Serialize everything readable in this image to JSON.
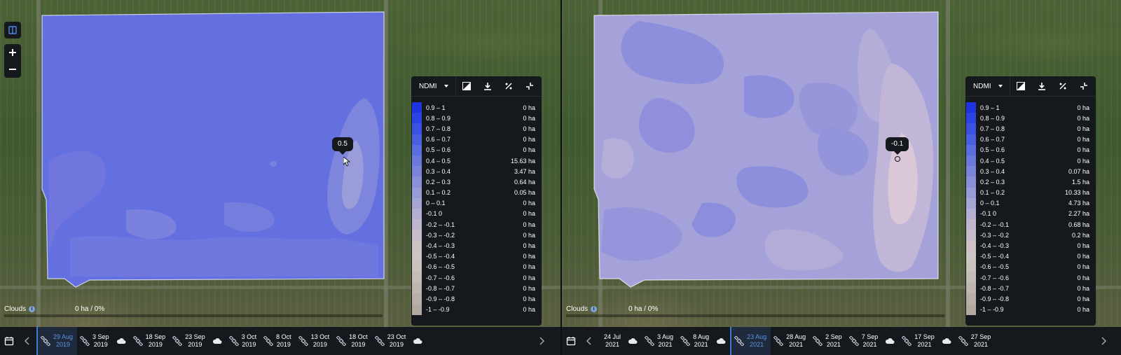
{
  "left": {
    "index_name": "NDMI",
    "tooltip_value": "0.5",
    "clouds_label": "Clouds",
    "clouds_info": "i",
    "area_pct": "0 ha / 0%",
    "legend": [
      {
        "range": "0.9 – 1",
        "area": "0 ha"
      },
      {
        "range": "0.8 – 0.9",
        "area": "0 ha"
      },
      {
        "range": "0.7 – 0.8",
        "area": "0 ha"
      },
      {
        "range": "0.6 – 0.7",
        "area": "0 ha"
      },
      {
        "range": "0.5 – 0.6",
        "area": "0 ha"
      },
      {
        "range": "0.4 – 0.5",
        "area": "15.63 ha"
      },
      {
        "range": "0.3 – 0.4",
        "area": "3.47 ha"
      },
      {
        "range": "0.2 – 0.3",
        "area": "0.64 ha"
      },
      {
        "range": "0.1 – 0.2",
        "area": "0.05 ha"
      },
      {
        "range": "0 – 0.1",
        "area": "0 ha"
      },
      {
        "range": "-0.1 0",
        "area": "0 ha"
      },
      {
        "range": "-0.2 – -0.1",
        "area": "0 ha"
      },
      {
        "range": "-0.3 – -0.2",
        "area": "0 ha"
      },
      {
        "range": "-0.4 – -0.3",
        "area": "0 ha"
      },
      {
        "range": "-0.5 – -0.4",
        "area": "0 ha"
      },
      {
        "range": "-0.6 – -0.5",
        "area": "0 ha"
      },
      {
        "range": "-0.7 – -0.6",
        "area": "0 ha"
      },
      {
        "range": "-0.8 – -0.7",
        "area": "0 ha"
      },
      {
        "range": "-0.9 – -0.8",
        "area": "0 ha"
      },
      {
        "range": "-1 – -0.9",
        "area": "0 ha"
      }
    ],
    "timeline": [
      {
        "day": "29 Aug",
        "year": "2019",
        "icon": "satellite",
        "active": true
      },
      {
        "day": "3 Sep",
        "year": "2019",
        "icon": "satellite",
        "active": false
      },
      {
        "day": "",
        "year": "",
        "icon": "cloud",
        "active": false
      },
      {
        "day": "18 Sep",
        "year": "2019",
        "icon": "satellite",
        "active": false
      },
      {
        "day": "23 Sep",
        "year": "2019",
        "icon": "satellite",
        "active": false
      },
      {
        "day": "",
        "year": "",
        "icon": "cloud",
        "active": false
      },
      {
        "day": "3 Oct",
        "year": "2019",
        "icon": "satellite",
        "active": false
      },
      {
        "day": "8 Oct",
        "year": "2019",
        "icon": "satellite",
        "active": false
      },
      {
        "day": "13 Oct",
        "year": "2019",
        "icon": "satellite",
        "active": false
      },
      {
        "day": "18 Oct",
        "year": "2019",
        "icon": "satellite",
        "active": false
      },
      {
        "day": "23 Oct",
        "year": "2019",
        "icon": "satellite",
        "active": false
      },
      {
        "day": "",
        "year": "",
        "icon": "cloud",
        "active": false
      }
    ]
  },
  "right": {
    "index_name": "NDMI",
    "tooltip_value": "-0.1",
    "clouds_label": "Clouds",
    "clouds_info": "i",
    "area_pct": "0 ha / 0%",
    "legend": [
      {
        "range": "0.9 – 1",
        "area": "0 ha"
      },
      {
        "range": "0.8 – 0.9",
        "area": "0 ha"
      },
      {
        "range": "0.7 – 0.8",
        "area": "0 ha"
      },
      {
        "range": "0.6 – 0.7",
        "area": "0 ha"
      },
      {
        "range": "0.5 – 0.6",
        "area": "0 ha"
      },
      {
        "range": "0.4 – 0.5",
        "area": "0 ha"
      },
      {
        "range": "0.3 – 0.4",
        "area": "0.07 ha"
      },
      {
        "range": "0.2 – 0.3",
        "area": "1.5 ha"
      },
      {
        "range": "0.1 – 0.2",
        "area": "10.33 ha"
      },
      {
        "range": "0 – 0.1",
        "area": "4.73 ha"
      },
      {
        "range": "-0.1 0",
        "area": "2.27 ha"
      },
      {
        "range": "-0.2 – -0.1",
        "area": "0.68 ha"
      },
      {
        "range": "-0.3 – -0.2",
        "area": "0.2 ha"
      },
      {
        "range": "-0.4 – -0.3",
        "area": "0 ha"
      },
      {
        "range": "-0.5 – -0.4",
        "area": "0 ha"
      },
      {
        "range": "-0.6 – -0.5",
        "area": "0 ha"
      },
      {
        "range": "-0.7 – -0.6",
        "area": "0 ha"
      },
      {
        "range": "-0.8 – -0.7",
        "area": "0 ha"
      },
      {
        "range": "-0.9 – -0.8",
        "area": "0 ha"
      },
      {
        "range": "-1 – -0.9",
        "area": "0 ha"
      }
    ],
    "timeline": [
      {
        "day": "24 Jul",
        "year": "2021",
        "icon": "none",
        "active": false
      },
      {
        "day": "",
        "year": "",
        "icon": "cloud",
        "active": false
      },
      {
        "day": "3 Aug",
        "year": "2021",
        "icon": "satellite",
        "active": false
      },
      {
        "day": "8 Aug",
        "year": "2021",
        "icon": "satellite",
        "active": false
      },
      {
        "day": "",
        "year": "",
        "icon": "cloud",
        "active": false
      },
      {
        "day": "23 Aug",
        "year": "2021",
        "icon": "satellite",
        "active": true
      },
      {
        "day": "28 Aug",
        "year": "2021",
        "icon": "satellite",
        "active": false
      },
      {
        "day": "2 Sep",
        "year": "2021",
        "icon": "satellite",
        "active": false
      },
      {
        "day": "7 Sep",
        "year": "2021",
        "icon": "satellite",
        "active": false
      },
      {
        "day": "",
        "year": "",
        "icon": "cloud",
        "active": false
      },
      {
        "day": "17 Sep",
        "year": "2021",
        "icon": "satellite",
        "active": false
      },
      {
        "day": "",
        "year": "",
        "icon": "cloud",
        "active": false
      },
      {
        "day": "27 Sep",
        "year": "2021",
        "icon": "satellite",
        "active": false
      }
    ]
  },
  "swatch_colors": [
    "#1d34e0",
    "#2b43e2",
    "#3a51e2",
    "#4b60e1",
    "#5a6ee0",
    "#6b79dd",
    "#7a84db",
    "#8a90d8",
    "#989cd6",
    "#a6a6d4",
    "#b4afd2",
    "#c0b5cf",
    "#c9bcca",
    "#cdc1c6",
    "#cdc5c3",
    "#c9c2bd",
    "#c4bcb7",
    "#bfb6b0",
    "#b9afa8",
    "#b3a9a1"
  ],
  "field_colors": {
    "left_base": "#6570e0",
    "left_light": "#7d85dc",
    "left_lighter": "#9a9dd9",
    "right_base": "#a5a2da",
    "right_dark": "#8e8fdc",
    "right_light": "#c2b6d8",
    "right_lightest": "#dac8d8"
  }
}
